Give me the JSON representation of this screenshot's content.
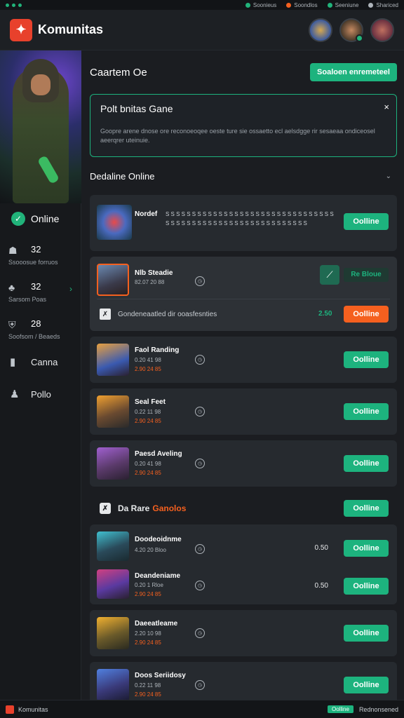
{
  "topbar": {
    "links": [
      {
        "label": "Soonieus",
        "color": "#21b37a"
      },
      {
        "label": "Soondlos",
        "color": "#f5601f"
      },
      {
        "label": "Seeniune",
        "color": "#21b37a"
      },
      {
        "label": "Shariced",
        "color": "#aeb4ba"
      }
    ]
  },
  "header": {
    "brand": "Komunitas",
    "logo_icon": "fox-shield-icon"
  },
  "sidebar": {
    "status": "Online",
    "stats": [
      {
        "value": "32",
        "label": "Ssooosue forruos",
        "icon": "users-icon"
      },
      {
        "value": "32",
        "label": "Sarsom Poas",
        "icon": "group-icon"
      },
      {
        "value": "28",
        "label": "Soofsom / Beaeds",
        "icon": "shield-icon"
      }
    ],
    "nav": [
      {
        "label": "Canna",
        "icon": "bookmark-icon"
      },
      {
        "label": "Pollo",
        "icon": "people-icon"
      }
    ]
  },
  "main": {
    "title": "Caartem Oe",
    "cta": "Soaloen enremeteel",
    "notice": {
      "title": "Polt bnitas Gane",
      "body": "Goopre arene dnose ore reconoeoqee oeste ture sie ossaetto ecl aelsdgge rir sesaeaa ondiceosel aeerqrer uteinuie.",
      "close": "×"
    },
    "section_title": "Dedaline Online",
    "cards": [
      {
        "name": "Nordef",
        "meta": "",
        "price": "",
        "action": "Oolline",
        "action_style": "green",
        "desc": "S S S S S S S S S S S S S S S S S S S S S S S S S S S S S S S S S S S S S S S S S S S S S S S S S S S S S S S S S S S"
      },
      {
        "name": "Nlb Steadie",
        "meta": "82.07 20 88",
        "price": "",
        "action": "Oolline",
        "action_style": "orange",
        "secondary": "Re Bloue",
        "note": "Gondeneaatled dir ooasfesnties",
        "amount": "2.50"
      },
      {
        "name": "Faol Randing",
        "meta": "0.20 41 98",
        "price": "2.90 24 85",
        "action": "Oolline",
        "action_style": "green"
      },
      {
        "name": "Seal Feet",
        "meta": "0.22 11 98",
        "price": "2.90 24 85",
        "action": "Oolline",
        "action_style": "green"
      },
      {
        "name": "Paesd Aveling",
        "meta": "0.20 41 98",
        "price": "2.90 24 85",
        "action": "Oolline",
        "action_style": "green"
      }
    ],
    "subsection": {
      "label": "Da Rare",
      "accent": "Ganolos",
      "button": "Oolline"
    },
    "cards2": [
      {
        "name": "Doodeoidnme",
        "meta": "4.20 20 Bloo",
        "num": "0.50",
        "action": "Oolline"
      },
      {
        "name": "Deandeniame",
        "meta": "0.20 1 Rloe",
        "price": "2.90 24 85",
        "num": "0.50",
        "action": "Oolline"
      },
      {
        "name": "Daeeatleame",
        "meta": "2.20 10 98",
        "price": "2.90 24 85",
        "action": "Oolline"
      },
      {
        "name": "Doos Seriidosy",
        "meta": "0.22 11 98",
        "price": "2.90 24 85",
        "action": "Oolline"
      }
    ]
  },
  "footer": {
    "left": "Komunitas",
    "badge": "Oolline",
    "right": "Rednonsened"
  }
}
